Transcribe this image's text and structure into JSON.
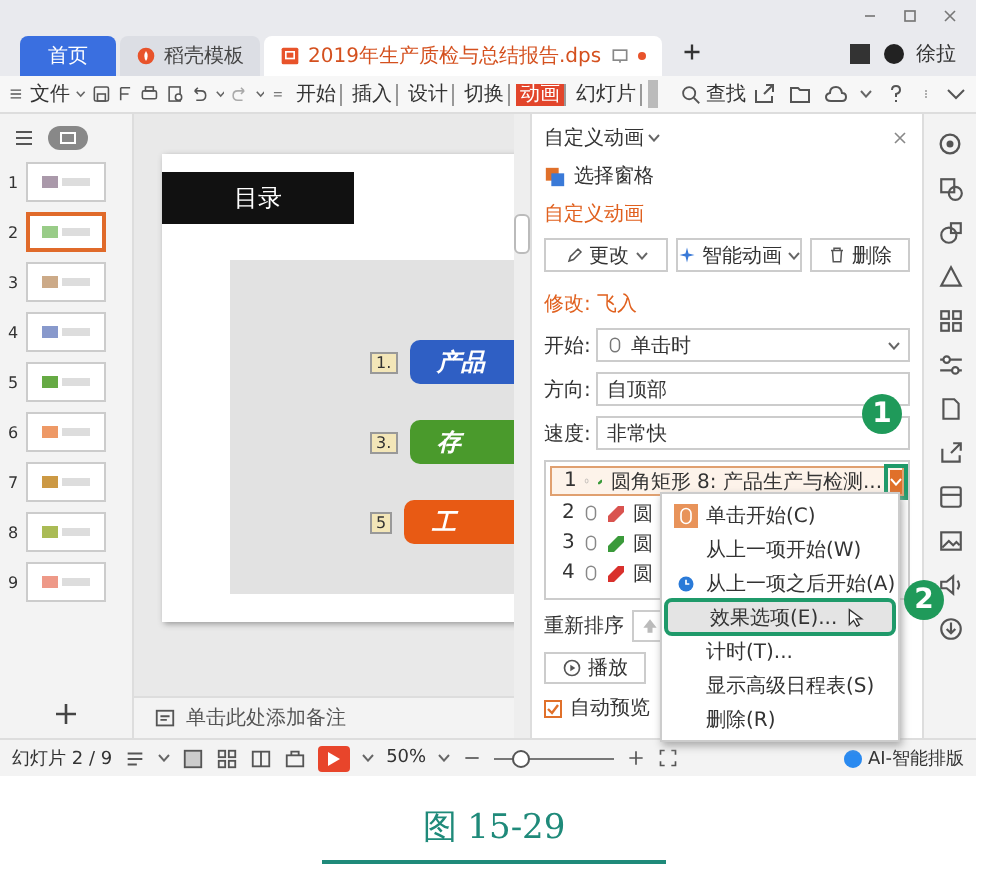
{
  "tabs": [
    {
      "label": "首页",
      "kind": "home",
      "selected": false
    },
    {
      "label": "稻壳模板",
      "kind": "template",
      "selected": false
    },
    {
      "label": "2019年生产质检与总结报告.dps",
      "kind": "document",
      "selected": true
    }
  ],
  "user": {
    "name": "徐拉"
  },
  "toolbar": {
    "file_menu": "文件",
    "ribbon_tabs": [
      {
        "label": "开始",
        "selected": false
      },
      {
        "label": "插入",
        "selected": false
      },
      {
        "label": "设计",
        "selected": false
      },
      {
        "label": "切换",
        "selected": false
      },
      {
        "label": "动画",
        "selected": true
      },
      {
        "label": "幻灯片",
        "selected": false
      }
    ],
    "search": "查找"
  },
  "thumbnails": [
    {
      "number": "1",
      "selected": false
    },
    {
      "number": "2",
      "selected": true
    },
    {
      "number": "3",
      "selected": false
    },
    {
      "number": "4",
      "selected": false
    },
    {
      "number": "5",
      "selected": false
    },
    {
      "number": "6",
      "selected": false
    },
    {
      "number": "7",
      "selected": false
    },
    {
      "number": "8",
      "selected": false
    },
    {
      "number": "9",
      "selected": false
    }
  ],
  "slide": {
    "title": "目录",
    "items": [
      {
        "badge": "1.",
        "label": "产品",
        "color": "#2f5fc4"
      },
      {
        "badge": "3.",
        "label": "存",
        "color": "#4a9a2c"
      },
      {
        "badge": "5",
        "label": "工",
        "color": "#e85a14"
      }
    ]
  },
  "notes_placeholder": "单击此处添加备注",
  "panel": {
    "title": "自定义动画",
    "selection_pane": "选择窗格",
    "section": "自定义动画",
    "buttons": [
      "更改",
      "智能动画",
      "删除"
    ],
    "modify": "修改: 飞入",
    "fields": [
      {
        "label": "开始:",
        "value": "单击时",
        "kind": "dropdown"
      },
      {
        "label": "方向:",
        "value": "自顶部",
        "kind": "text"
      },
      {
        "label": "速度:",
        "value": "非常快",
        "kind": "text"
      }
    ],
    "animations": [
      {
        "number": "1",
        "text": "圆角矩形 8: 产品生产与检测...",
        "color": "#3a9a3a",
        "selected": true
      },
      {
        "number": "2",
        "text": "圆",
        "color": "#d9534f",
        "selected": false
      },
      {
        "number": "3",
        "text": "圆",
        "color": "#3a9a3a",
        "selected": false
      },
      {
        "number": "4",
        "text": "圆",
        "color": "#d9302c",
        "selected": false
      }
    ],
    "reorder": "重新排序",
    "play": "播放",
    "autopreview": {
      "label": "自动预览",
      "checked": true
    }
  },
  "context_menu": [
    {
      "label": "单击开始(C)",
      "kind": "checked"
    },
    {
      "label": "从上一项开始(W)",
      "kind": "plain"
    },
    {
      "label": "从上一项之后开始(A)",
      "kind": "clock"
    },
    {
      "label": "效果选项(E)...",
      "kind": "plain",
      "highlighted": true
    },
    {
      "label": "计时(T)...",
      "kind": "plain"
    },
    {
      "label": "显示高级日程表(S)",
      "kind": "plain"
    },
    {
      "label": "删除(R)",
      "kind": "plain"
    }
  ],
  "callouts": [
    "1",
    "2"
  ],
  "status_bar": {
    "slide_counter": "幻灯片 2 / 9",
    "zoom": "50%",
    "zoom_slider": {
      "level": 0.22
    },
    "ai_button": "AI-智能排版"
  },
  "caption": "图 15-29"
}
